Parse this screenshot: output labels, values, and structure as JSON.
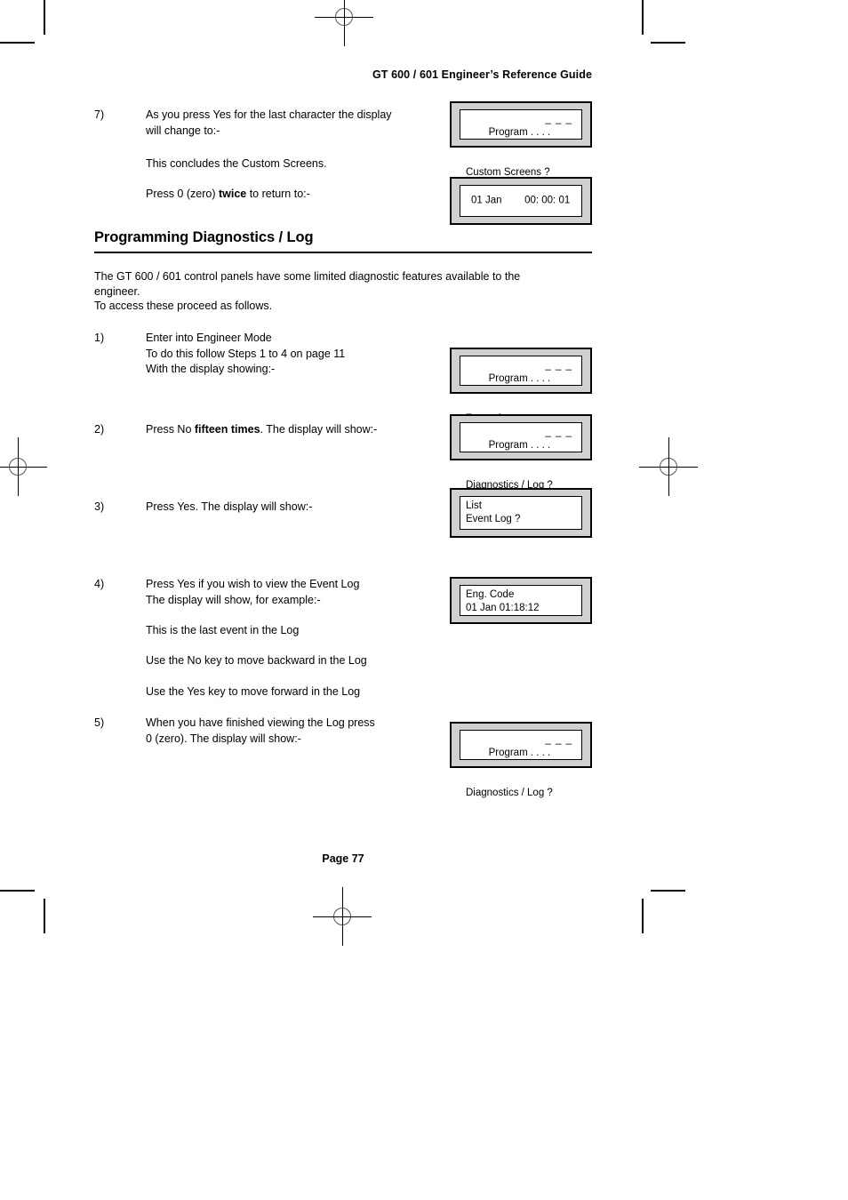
{
  "document": {
    "header_title": "GT 600 / 601 Engineer’s Reference Guide",
    "section_heading": "Programming Diagnostics / Log",
    "footer": "Page  77"
  },
  "intro": {
    "line1": "The GT 600 / 601 control panels have some limited diagnostic features available to the",
    "line2": "engineer.",
    "line3": "To access these proceed as follows."
  },
  "steps": [
    {
      "number": "7)",
      "line1": "As you press Yes for the last character the display",
      "line2": "will change to:-"
    },
    {
      "number": "1)",
      "line1": "Enter into Engineer Mode",
      "line2": "To do this follow Steps 1 to 4 on page 11",
      "line3": "With the display showing:-"
    },
    {
      "number": "2)",
      "text_before": "Press No ",
      "text_bold": "fifteen times",
      "text_after": ". The display will show:-"
    },
    {
      "number": "3)",
      "line1": "Press Yes. The display will show:-"
    },
    {
      "number": "4)",
      "line1": "Press Yes if you wish to view the Event Log",
      "line2": "The display will show, for example:-"
    },
    {
      "number": "5)",
      "line1": "When you have finished viewing the Log press",
      "line2": "0 (zero). The display will show:-"
    }
  ],
  "notes": {
    "concludes": "This concludes the Custom Screens.",
    "press_zero_before": "Press 0 (zero) ",
    "press_zero_bold": "twice",
    "press_zero_after": " to return to:-",
    "last_event": "This is the last event in the Log",
    "no_key": "Use the No key to move backward in the Log",
    "yes_key": "Use the Yes key to move forward in the Log"
  },
  "displays": [
    {
      "id": "custom-screens",
      "line1": "Program . . . .",
      "dashes": "_ _ _",
      "line2": "Custom Screens ?"
    },
    {
      "id": "clock",
      "centered": "01 Jan        00: 00: 01"
    },
    {
      "id": "zones",
      "line1": "Program . . . .",
      "dashes": "_ _ _",
      "line2": "Zones ?"
    },
    {
      "id": "diagnostics-log",
      "line1": "Program . . . .",
      "dashes": "_ _ _",
      "line2": "Diagnostics / Log ?"
    },
    {
      "id": "event-log-list",
      "line1": "List",
      "line2": "Event Log ?"
    },
    {
      "id": "eng-code",
      "line1": "Eng. Code",
      "line2": "01 Jan 01:18:12"
    },
    {
      "id": "diagnostics-log-return",
      "line1": "Program . . . .",
      "dashes": "_ _ _",
      "line2": "Diagnostics / Log ?"
    }
  ],
  "colors": {
    "lcd_bezel": "#d0d0d0",
    "lcd_screen": "#ffffff",
    "ink": "#000000"
  }
}
